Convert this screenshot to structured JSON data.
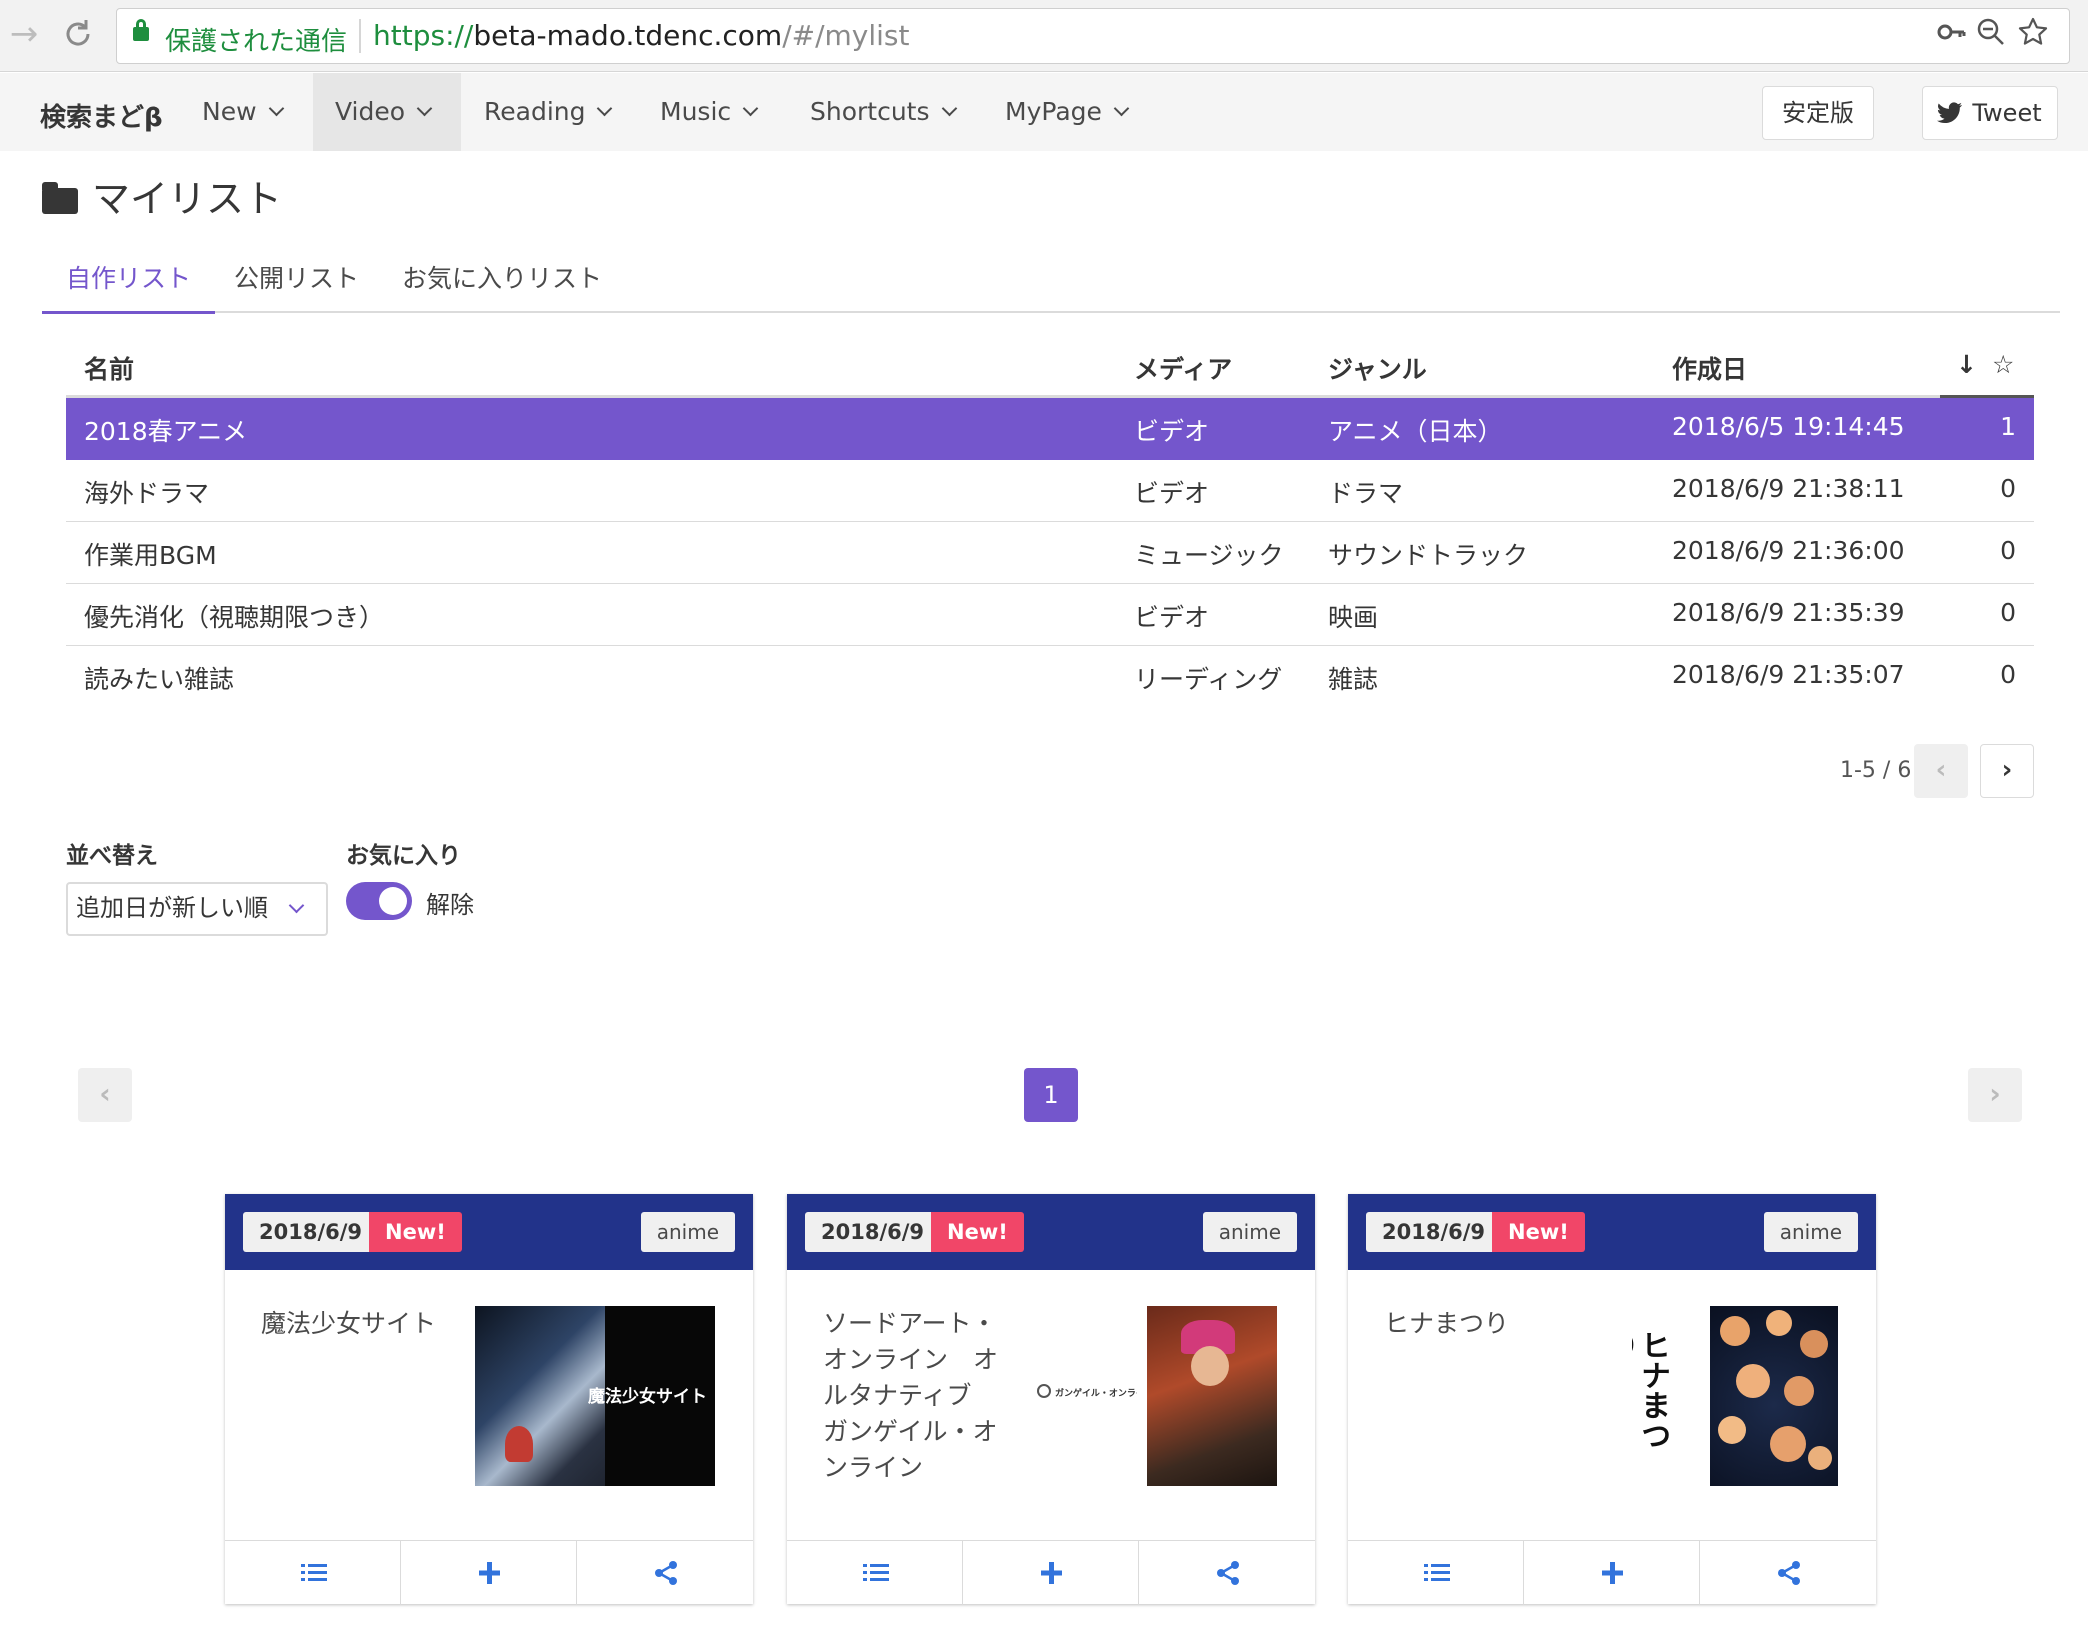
{
  "browser": {
    "secure_label": "保護された通信",
    "url_scheme": "https://",
    "url_host": "beta-mado.tdenc.com",
    "url_path": "/#/mylist",
    "icons": [
      "back-arrow-icon",
      "reload-icon",
      "lock-icon",
      "key-icon",
      "zoom-out-icon",
      "star-icon"
    ]
  },
  "navbar": {
    "brand": "検索まどβ",
    "menu": [
      {
        "label": "New"
      },
      {
        "label": "Video"
      },
      {
        "label": "Reading"
      },
      {
        "label": "Music"
      },
      {
        "label": "Shortcuts"
      },
      {
        "label": "MyPage"
      }
    ],
    "stable_label": "安定版",
    "tweet_label": "Tweet"
  },
  "page": {
    "title": "マイリスト",
    "tabs": [
      "自作リスト",
      "公開リスト",
      "お気に入りリスト"
    ],
    "active_tab": "自作リスト"
  },
  "table": {
    "headers": {
      "name": "名前",
      "media": "メディア",
      "genre": "ジャンル",
      "created": "作成日",
      "sort": "↓",
      "star": "☆"
    },
    "rows": [
      {
        "name": "2018春アニメ",
        "media": "ビデオ",
        "genre": "アニメ（日本）",
        "created": "2018/6/5 19:14:45",
        "stars": "1",
        "selected": true
      },
      {
        "name": "海外ドラマ",
        "media": "ビデオ",
        "genre": "ドラマ",
        "created": "2018/6/9 21:38:11",
        "stars": "0"
      },
      {
        "name": "作業用BGM",
        "media": "ミュージック",
        "genre": "サウンドトラック",
        "created": "2018/6/9 21:36:00",
        "stars": "0"
      },
      {
        "name": "優先消化（視聴期限つき）",
        "media": "ビデオ",
        "genre": "映画",
        "created": "2018/6/9 21:35:39",
        "stars": "0"
      },
      {
        "name": "読みたい雑誌",
        "media": "リーディング",
        "genre": "雑誌",
        "created": "2018/6/9 21:35:07",
        "stars": "0"
      }
    ],
    "pagination": {
      "info": "1-5 / 6",
      "prev": "‹",
      "next": "›"
    }
  },
  "filters": {
    "sort_label": "並べ替え",
    "sort_value": "追加日が新しい順",
    "favorite_label": "お気に入り",
    "favorite_toggle_on": true,
    "favorite_toggle_text": "解除"
  },
  "card_pagination": {
    "current": "1",
    "prev": "‹",
    "next": "›"
  },
  "cards": [
    {
      "date": "2018/6/9",
      "new": "New!",
      "category": "anime",
      "title": "魔法少女サイト",
      "image_text": "魔法少女サイト"
    },
    {
      "date": "2018/6/9",
      "new": "New!",
      "category": "anime",
      "title": "ソードアート・オンライン　オルタナティブ ガンゲイル・オンライン",
      "image_text": "ガンゲイル・オンライン"
    },
    {
      "date": "2018/6/9",
      "new": "New!",
      "category": "anime",
      "title": "ヒナまつり",
      "image_text": "ヒナまつり"
    }
  ],
  "colors": {
    "accent": "#7456cc",
    "card_header": "#22338a",
    "new_badge": "#f14668",
    "secure": "#1e8e3e"
  }
}
